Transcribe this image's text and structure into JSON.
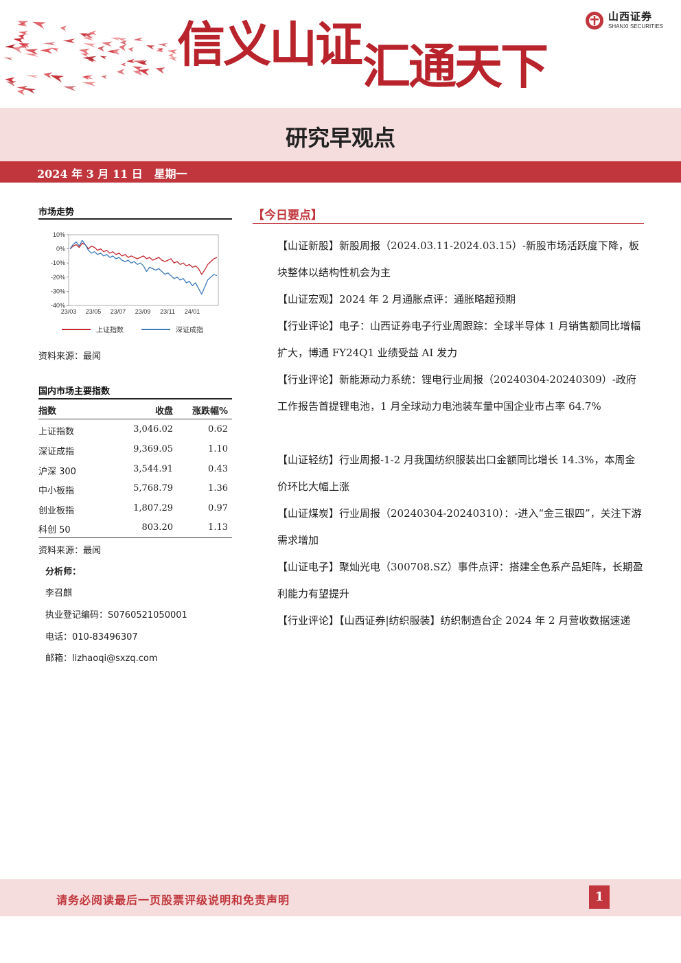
{
  "header": {
    "logo_cn": "山西证券",
    "logo_en": "SHANXI SECURITIES",
    "slogan_part1": "信义山证",
    "slogan_part2": "汇通天下",
    "report_title": "研究早观点",
    "date": "2024 年 3 月 11 日",
    "weekday": "星期一",
    "brand_color": "#c0363c"
  },
  "market_trend": {
    "title": "市场走势",
    "source": "资料来源：最闻",
    "chart_data": {
      "type": "line",
      "x_ticks": [
        "23/03",
        "23/05",
        "23/07",
        "23/09",
        "23/11",
        "24/01"
      ],
      "y_ticks": [
        "10%",
        "0%",
        "-10%",
        "-20%",
        "-30%",
        "-40%"
      ],
      "ylim": [
        -40,
        10
      ],
      "series": [
        {
          "name": "上证指数",
          "color": "#c0262e",
          "values": [
            0,
            2,
            3,
            1,
            4,
            3,
            0,
            2,
            1,
            -1,
            0,
            -2,
            -1,
            -3,
            -2,
            -4,
            -3,
            -5,
            -4,
            -6,
            -5,
            -6,
            -7,
            -6,
            -5,
            -7,
            -6,
            -8,
            -7,
            -6,
            -8,
            -9,
            -8,
            -7,
            -10,
            -9,
            -11,
            -10,
            -12,
            -11,
            -13,
            -12,
            -14,
            -18,
            -15,
            -11,
            -9,
            -7,
            -6
          ]
        },
        {
          "name": "深证成指",
          "color": "#3a78b8",
          "values": [
            0,
            3,
            5,
            2,
            6,
            3,
            -1,
            -3,
            -2,
            -4,
            -3,
            -5,
            -4,
            -6,
            -5,
            -7,
            -6,
            -8,
            -9,
            -8,
            -10,
            -9,
            -11,
            -10,
            -12,
            -16,
            -13,
            -14,
            -15,
            -14,
            -16,
            -18,
            -17,
            -19,
            -21,
            -20,
            -22,
            -21,
            -24,
            -23,
            -26,
            -24,
            -28,
            -32,
            -27,
            -22,
            -20,
            -18,
            -19
          ]
        }
      ]
    }
  },
  "index_table": {
    "title": "国内市场主要指数",
    "headers": [
      "指数",
      "收盘",
      "涨跌幅%"
    ],
    "rows": [
      [
        "上证指数",
        "3,046.02",
        "0.62"
      ],
      [
        "深证成指",
        "9,369.05",
        "1.10"
      ],
      [
        "沪深 300",
        "3,544.91",
        "0.43"
      ],
      [
        "中小板指",
        "5,768.79",
        "1.36"
      ],
      [
        "创业板指",
        "1,807.29",
        "0.97"
      ],
      [
        "科创 50",
        "803.20",
        "1.13"
      ]
    ],
    "source": "资料来源：最闻"
  },
  "analyst": {
    "label": "分析师：",
    "name": "李召麒",
    "license": "执业登记编码：S0760521050001",
    "phone": "电话：010-83496307",
    "email": "邮箱：lizhaoqi@sxzq.com"
  },
  "key_points": {
    "title": "【今日要点】",
    "items": [
      "【山证新股】新股周报（2024.03.11-2024.03.15）-新股市场活跃度下降，板块整体以结构性机会为主",
      "【山证宏观】2024 年 2 月通胀点评：通胀略超预期",
      "【行业评论】电子：山西证券电子行业周跟踪：全球半导体 1 月销售额同比增幅扩大，博通 FY24Q1 业绩受益 AI 发力",
      "【行业评论】新能源动力系统：锂电行业周报（20240304-20240309）-政府工作报告首提锂电池，1 月全球动力电池装车量中国企业市占率 64.7%",
      "【山证轻纺】行业周报-1-2 月我国纺织服装出口金额同比增长 14.3%，本周金价环比大幅上涨",
      "【山证煤炭】行业周报（20240304-20240310）：-进入“金三银四”，关注下游需求增加",
      "【山证电子】聚灿光电（300708.SZ）事件点评：搭建全色系产品矩阵，长期盈利能力有望提升",
      "【行业评论】【山西证券|纺织服装】纺织制造台企 2024 年 2 月营收数据速递"
    ]
  },
  "footer": {
    "disclaimer": "请务必阅读最后一页股票评级说明和免责声明",
    "page": "1"
  }
}
